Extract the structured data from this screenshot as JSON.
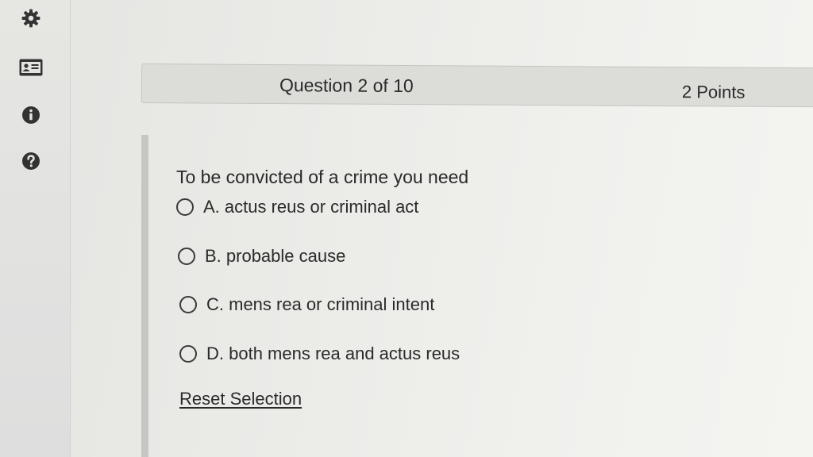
{
  "sidebar": {
    "icons": [
      "gear-icon",
      "id-card-icon",
      "info-icon",
      "help-icon"
    ]
  },
  "header": {
    "question_label": "Question 2 of 10",
    "points_label": "2 Points"
  },
  "question": {
    "prompt": "To be convicted of a crime you need",
    "options": [
      {
        "label": "A. actus reus or criminal act"
      },
      {
        "label": "B. probable cause"
      },
      {
        "label": "C. mens rea or criminal intent"
      },
      {
        "label": "D. both mens rea and actus reus"
      }
    ],
    "reset_label": "Reset Selection"
  }
}
